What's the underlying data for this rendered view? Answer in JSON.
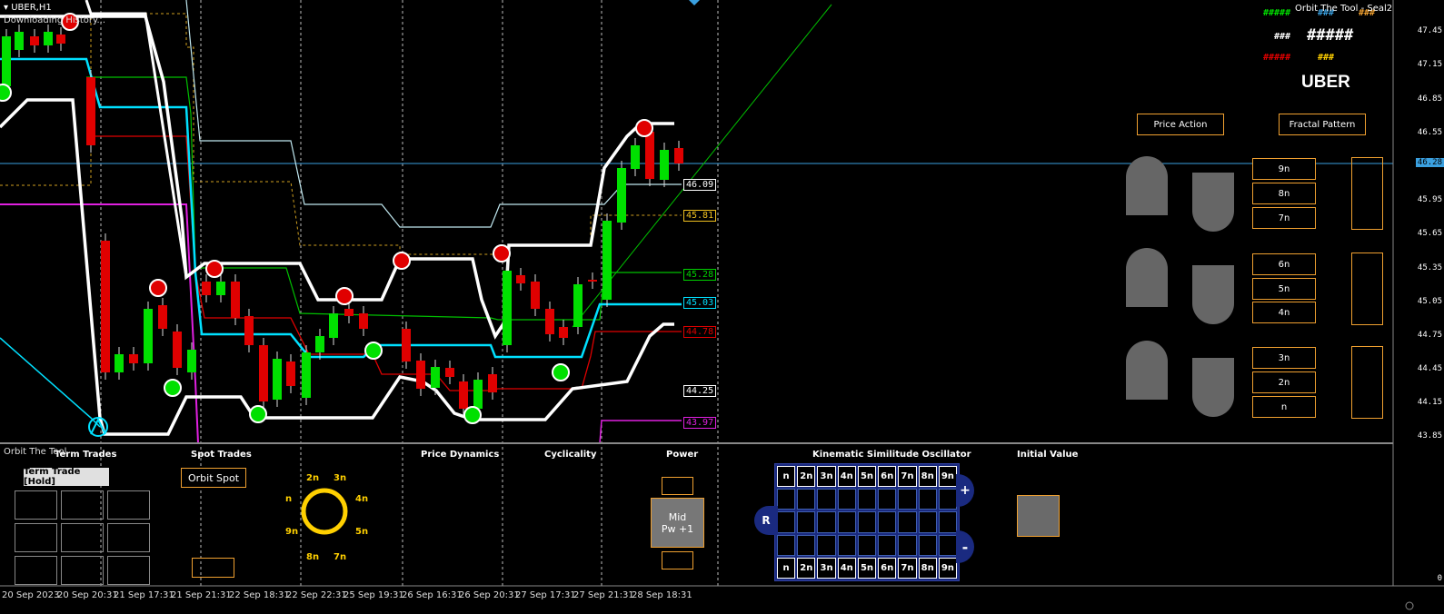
{
  "header": {
    "symbol": "UBER,H1",
    "status": "Downloading History..."
  },
  "top_right": {
    "row1": [
      "#####",
      "###",
      "###"
    ],
    "row2": [
      "###",
      "#####"
    ],
    "row3": [
      "#####",
      "###"
    ],
    "indicator_title": "Orbit The Tool - Seal2",
    "ticker": "UBER"
  },
  "panels": {
    "price_action": "Price Action",
    "fractal_pattern": "Fractal Pattern",
    "levels_a": [
      "9n",
      "8n",
      "7n"
    ],
    "levels_b": [
      "6n",
      "5n",
      "4n"
    ],
    "levels_c": [
      "3n",
      "2n",
      "n"
    ]
  },
  "price_axis": [
    "47.45",
    "47.15",
    "46.85",
    "46.55",
    "46.28",
    "45.95",
    "45.65",
    "45.35",
    "45.05",
    "44.75",
    "44.45",
    "44.15",
    "43.85"
  ],
  "price_levels": {
    "l1": "46.09",
    "l2": "45.81",
    "l3": "45.28",
    "l4": "45.03",
    "l5": "44.78",
    "l6": "44.25",
    "l7": "43.97"
  },
  "subwindow": {
    "title": "Orbit The Tool",
    "term_trades": "Term Trades",
    "term_trade_button": "Term Trade [Hold]",
    "spot_trades": "Spot Trades",
    "orbit_spot": "Orbit Spot",
    "price_dynamics": "Price Dynamics",
    "cyclicality": "Cyclicality",
    "power": "Power",
    "power_mid": "Mid",
    "power_value": "Pw +1",
    "kinematic_title": "Kinematic Similitude Oscillator",
    "initial_value": "Initial Value",
    "orbit_labels": {
      "top_left": "2n",
      "top_right": "3n",
      "left": "n",
      "right": "4n",
      "bl": "9n",
      "br": "5n",
      "bot_left": "8n",
      "bot_right": "7n"
    },
    "k_headers": [
      "n",
      "2n",
      "3n",
      "4n",
      "5n",
      "6n",
      "7n",
      "8n",
      "9n"
    ],
    "k_plus": "+",
    "k_minus": "-",
    "k_reset": "R",
    "sub_axis": "0"
  },
  "dates": [
    "20 Sep 2023",
    "20 Sep 20:31",
    "21 Sep 17:31",
    "21 Sep 21:31",
    "22 Sep 18:31",
    "22 Sep 22:31",
    "25 Sep 19:31",
    "26 Sep 16:31",
    "26 Sep 20:31",
    "27 Sep 17:31",
    "27 Sep 21:31",
    "28 Sep 18:31"
  ],
  "colors": {
    "bull": "#00e000",
    "bear": "#e00000",
    "cyan": "#00e0ff",
    "white": "#ffffff",
    "orange": "#f0a030",
    "magenta": "#e020e0"
  }
}
